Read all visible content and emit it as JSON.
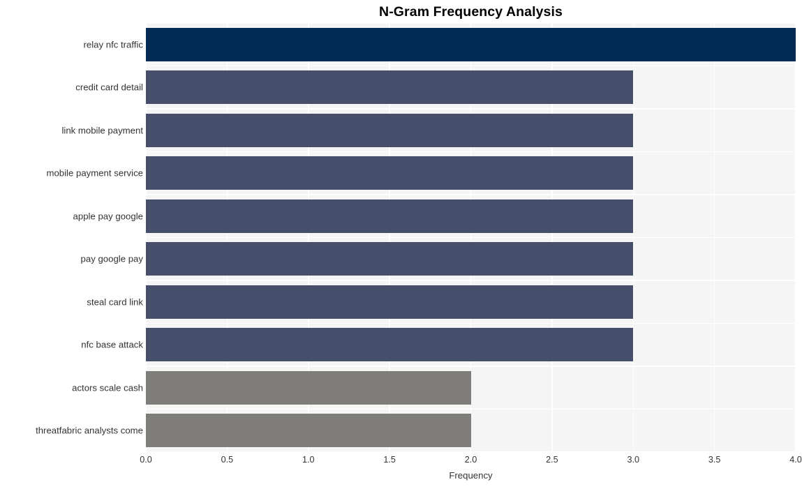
{
  "chart_data": {
    "type": "bar",
    "orientation": "horizontal",
    "title": "N-Gram Frequency Analysis",
    "xlabel": "Frequency",
    "ylabel": "",
    "xlim": [
      0.0,
      4.0
    ],
    "grid": true,
    "legend": "none",
    "categories": [
      "relay nfc traffic",
      "credit card detail",
      "link mobile payment",
      "mobile payment service",
      "apple pay google",
      "pay google pay",
      "steal card link",
      "nfc base attack",
      "actors scale cash",
      "threatfabric analysts come"
    ],
    "values": [
      4,
      3,
      3,
      3,
      3,
      3,
      3,
      3,
      2,
      2
    ],
    "bar_colors": [
      "#012a54",
      "#454f6c",
      "#454f6c",
      "#454f6c",
      "#454f6c",
      "#454f6c",
      "#454f6c",
      "#454f6c",
      "#7e7d7a",
      "#7e7d7a"
    ],
    "xticks": [
      "0.0",
      "0.5",
      "1.0",
      "1.5",
      "2.0",
      "2.5",
      "3.0",
      "3.5",
      "4.0"
    ],
    "xtick_values": [
      0.0,
      0.5,
      1.0,
      1.5,
      2.0,
      2.5,
      3.0,
      3.5,
      4.0
    ],
    "plot_background": "#f5f5f5",
    "figure_background": "#ffffff",
    "gridline_color": "#ffffff",
    "title_color": "#000000",
    "tick_label_color": "#333333"
  }
}
